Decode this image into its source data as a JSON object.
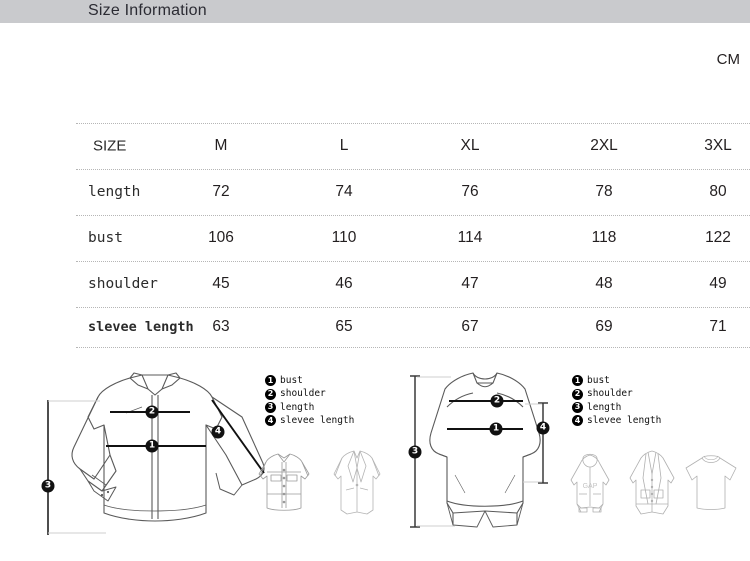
{
  "header": {
    "title": "Size Information",
    "band_color": "#c9cacd"
  },
  "table": {
    "unit": "CM",
    "columns": [
      "SIZE",
      "M",
      "L",
      "XL",
      "2XL",
      "3XL"
    ],
    "rows": [
      {
        "label": "length",
        "bold": false,
        "values": [
          "72",
          "74",
          "76",
          "78",
          "80"
        ]
      },
      {
        "label": "bust",
        "bold": false,
        "values": [
          "106",
          "110",
          "114",
          "118",
          "122"
        ]
      },
      {
        "label": "shoulder",
        "bold": false,
        "values": [
          "45",
          "46",
          "47",
          "48",
          "49"
        ]
      },
      {
        "label": "slevee length",
        "bold": true,
        "values": [
          "63",
          "65",
          "67",
          "69",
          "71"
        ]
      }
    ]
  },
  "diagrams": {
    "left": {
      "garment": "dress-shirt",
      "badges": [
        {
          "n": "1",
          "label": "bust"
        },
        {
          "n": "2",
          "label": "shoulder"
        },
        {
          "n": "3",
          "label": "length"
        },
        {
          "n": "4",
          "label": "slevee length"
        }
      ],
      "thumbnails": [
        "denim-jacket",
        "blazer"
      ]
    },
    "right": {
      "garment": "crewneck-sweatshirt",
      "badges": [
        {
          "n": "1",
          "label": "bust"
        },
        {
          "n": "2",
          "label": "shoulder"
        },
        {
          "n": "3",
          "label": "length"
        },
        {
          "n": "4",
          "label": "slevee length"
        }
      ],
      "thumbnails": [
        "hoodie",
        "cardigan",
        "t-shirt"
      ]
    }
  },
  "legend": {
    "items": [
      {
        "n": "1",
        "label": "bust"
      },
      {
        "n": "2",
        "label": " shoulder"
      },
      {
        "n": "3",
        "label": "length"
      },
      {
        "n": "4",
        "label": "slevee length"
      }
    ]
  },
  "colors": {
    "ink": "#231f20",
    "line": "#2b2b2b",
    "divider": "#b6b6b6",
    "header_band": "#c9cacd"
  }
}
